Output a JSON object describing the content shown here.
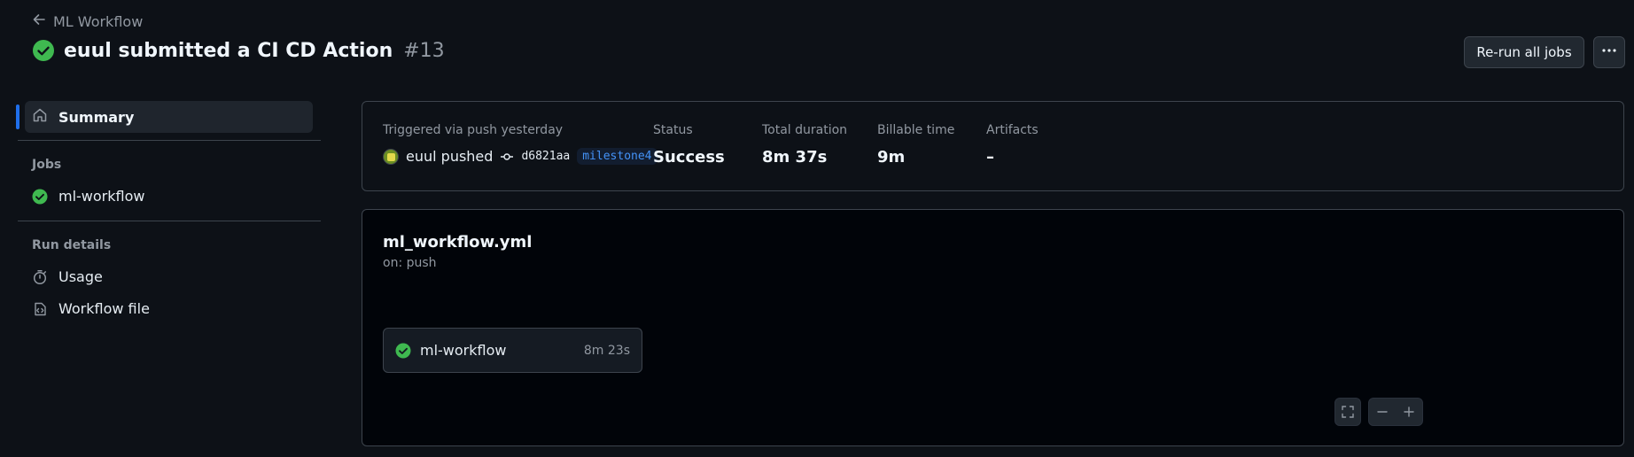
{
  "header": {
    "back_label": "ML Workflow",
    "title": "euul submitted a CI CD Action",
    "run_number": "#13",
    "rerun_label": "Re-run all jobs"
  },
  "sidebar": {
    "summary_label": "Summary",
    "jobs_heading": "Jobs",
    "jobs": [
      {
        "label": "ml-workflow",
        "status": "success"
      }
    ],
    "run_details_heading": "Run details",
    "usage_label": "Usage",
    "workflow_file_label": "Workflow file"
  },
  "summary": {
    "trigger_label": "Triggered via push yesterday",
    "actor": "euul pushed",
    "commit_sha": "d6821aa",
    "branch": "milestone4",
    "status_label": "Status",
    "status_value": "Success",
    "duration_label": "Total duration",
    "duration_value": "8m 37s",
    "billable_label": "Billable time",
    "billable_value": "9m",
    "artifacts_label": "Artifacts",
    "artifacts_value": "–"
  },
  "workflow": {
    "file_name": "ml_workflow.yml",
    "trigger": "on: push",
    "job": {
      "name": "ml-workflow",
      "duration": "8m 23s"
    }
  },
  "colors": {
    "background": "#0d1117",
    "success": "#3fb950",
    "accent": "#1f6feb",
    "branch_text": "#4493f8"
  }
}
